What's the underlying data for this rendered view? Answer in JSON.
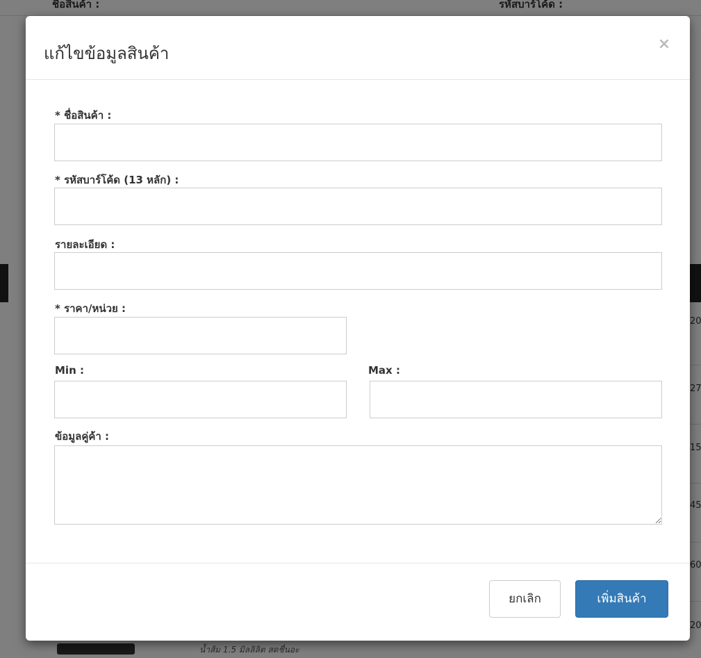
{
  "background": {
    "top_left_label": "ชื่อสินค้า :",
    "top_right_label": "รหัสบาร์โค้ด :",
    "right_column_numbers": [
      "20",
      "27",
      "15",
      "45",
      "60",
      "20"
    ],
    "bottom_text": "น้ำส้ม 1.5 มิลลิลิต สดชื่นอะ"
  },
  "modal": {
    "title": "แก้ไขข้อมูลสินค้า",
    "close_icon": "×",
    "fields": {
      "product_name": {
        "label": "* ชื่อสินค้า :",
        "value": "",
        "placeholder": ""
      },
      "barcode": {
        "label": "* รหัสบาร์โค้ด (13 หลัก) :",
        "value": "",
        "placeholder": ""
      },
      "details": {
        "label": "รายละเอียด :",
        "value": "",
        "placeholder": ""
      },
      "price": {
        "label": "* ราคา/หน่วย :",
        "value": "",
        "placeholder": ""
      },
      "min": {
        "label": "Min :",
        "value": "",
        "placeholder": ""
      },
      "max": {
        "label": "Max :",
        "value": "",
        "placeholder": ""
      },
      "supplier": {
        "label": "ข้อมูลคู่ค้า :",
        "value": "",
        "placeholder": ""
      }
    },
    "buttons": {
      "cancel": "ยกเลิก",
      "submit": "เพิ่มสินค้า"
    }
  },
  "colors": {
    "primary": "#337ab7",
    "overlay": "#7f7f7f"
  }
}
